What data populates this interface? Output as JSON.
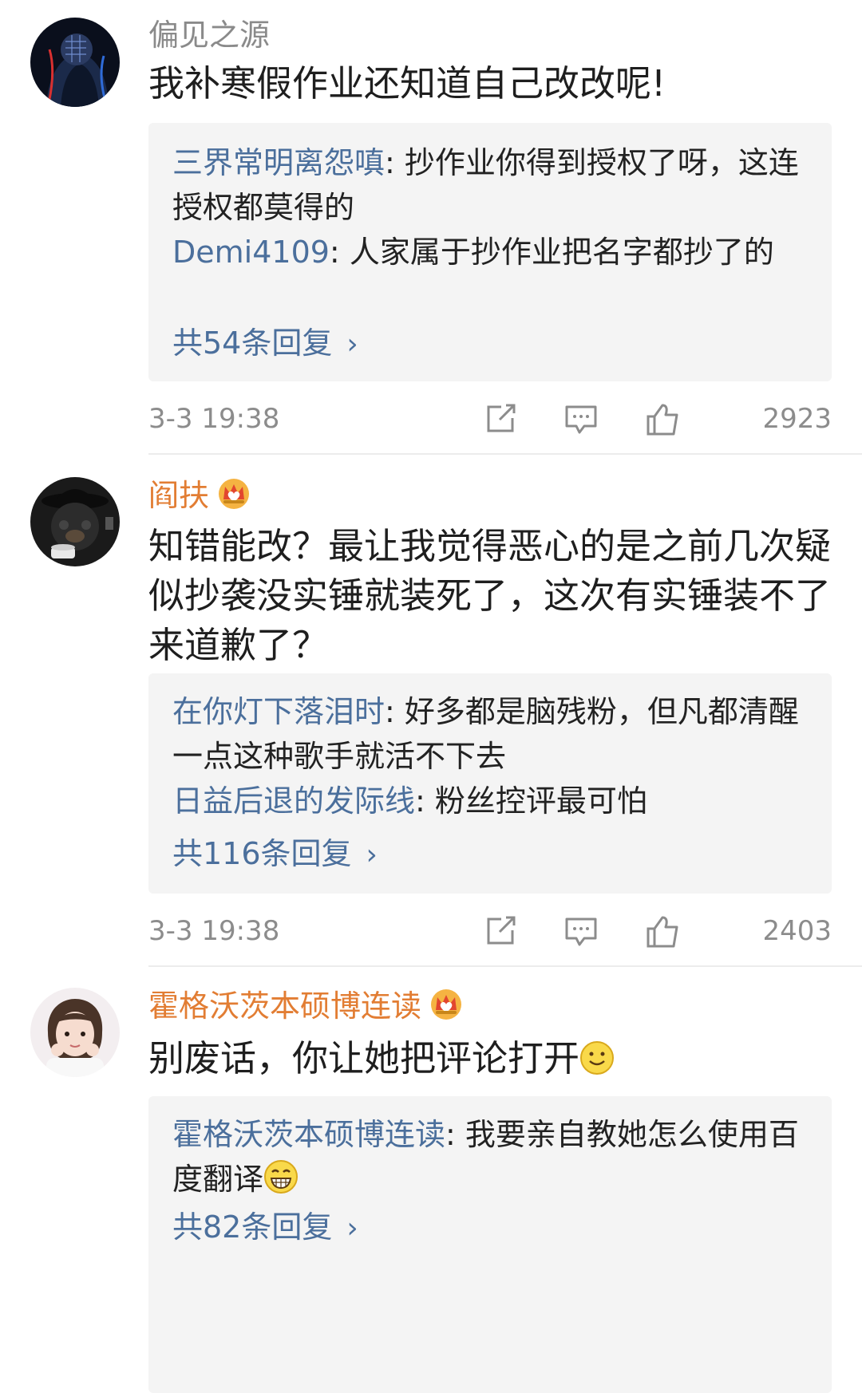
{
  "comments": [
    {
      "username": "偏见之源",
      "text": "我补寒假作业还知道自己改改呢!",
      "replies": [
        {
          "user": "三界常明离怨嗔",
          "sep": ": ",
          "text": "抄作业你得到授权了呀，这连授权都莫得的"
        },
        {
          "user": "Demi4109",
          "sep": ": ",
          "text": "人家属于抄作业把名字都抄了的"
        }
      ],
      "more_label": "共54条回复",
      "time": "3-3 19:38",
      "likes": "2923"
    },
    {
      "username": "阎扶",
      "text": "知错能改？最让我觉得恶心的是之前几次疑似抄袭没实锤就装死了，这次有实锤装不了来道歉了？",
      "replies": [
        {
          "user": "在你灯下落泪时",
          "sep": ": ",
          "text": "好多都是脑残粉，但凡都清醒一点这种歌手就活不下去"
        },
        {
          "user": "日益后退的发际线",
          "sep": ": ",
          "text": "粉丝控评最可怕"
        }
      ],
      "more_label": "共116条回复",
      "time": "3-3 19:38",
      "likes": "2403"
    },
    {
      "username": "霍格沃茨本硕博连读",
      "text": "别废话，你让她把评论打开",
      "replies": [
        {
          "user": "霍格沃茨本硕博连读",
          "sep": ": ",
          "text": "我要亲自教她怎么使用百度翻译"
        }
      ],
      "more_label": "共82条回复"
    }
  ],
  "colors": {
    "reply_user": "#4b6f9c",
    "vip_name": "#e27d33",
    "plain_name": "#8a8a8a",
    "reply_bg": "#f4f4f4",
    "meta": "#8c8c8c"
  },
  "icons": [
    "share-icon",
    "comment-icon",
    "like-icon",
    "crown-icon",
    "smile-emoji",
    "grin-emoji",
    "chevron-right-icon"
  ]
}
